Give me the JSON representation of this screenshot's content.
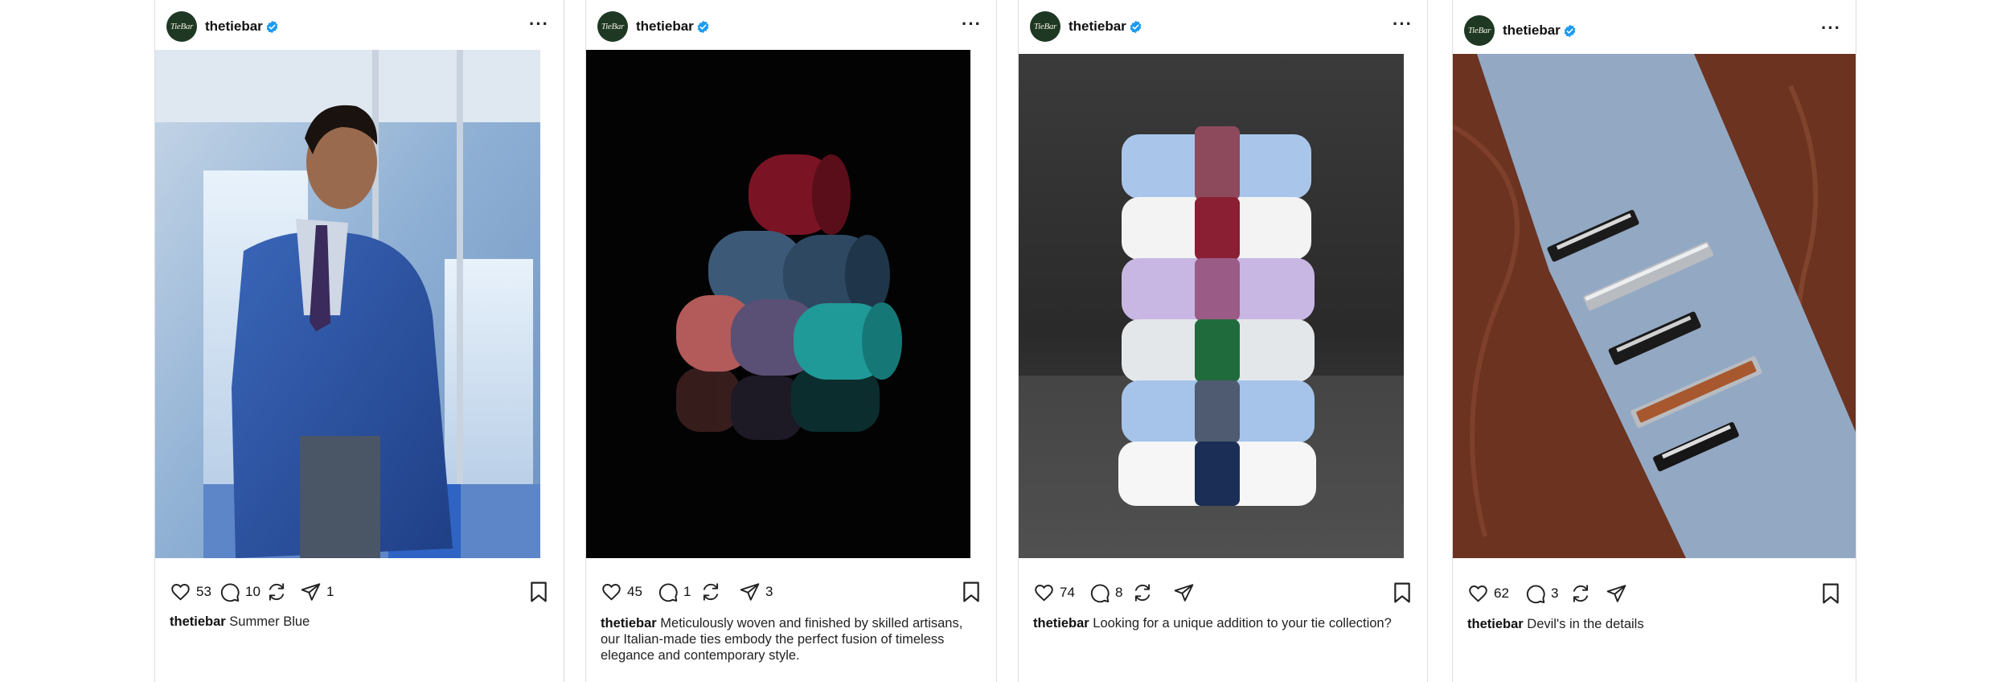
{
  "colors": {
    "avatar_bg": "#1e3823",
    "verified": "#1d9bf0",
    "icon": "#222222"
  },
  "icons": {
    "like": "heart-icon",
    "comment": "comment-icon",
    "repost": "repost-icon",
    "share": "send-icon",
    "save": "bookmark-icon",
    "menu": "more-icon"
  },
  "posts": [
    {
      "avatar": "TieBar",
      "username": "thetiebar",
      "likes": "53",
      "comments": "10",
      "shares": "1",
      "caption_user": "thetiebar",
      "caption": "Summer Blue"
    },
    {
      "avatar": "TieBar",
      "username": "thetiebar",
      "likes": "45",
      "comments": "1",
      "shares": "3",
      "caption_user": "thetiebar",
      "caption": "Meticulously woven and finished by skilled artisans, our Italian-made ties embody the perfect fusion of timeless elegance and contemporary style."
    },
    {
      "avatar": "TieBar",
      "username": "thetiebar",
      "likes": "74",
      "comments": "8",
      "shares": "",
      "caption_user": "thetiebar",
      "caption": "Looking for a unique addition to your tie collection?"
    },
    {
      "avatar": "TieBar",
      "username": "thetiebar",
      "likes": "62",
      "comments": "3",
      "shares": "",
      "caption_user": "thetiebar",
      "caption": "Devil's in the details"
    }
  ]
}
